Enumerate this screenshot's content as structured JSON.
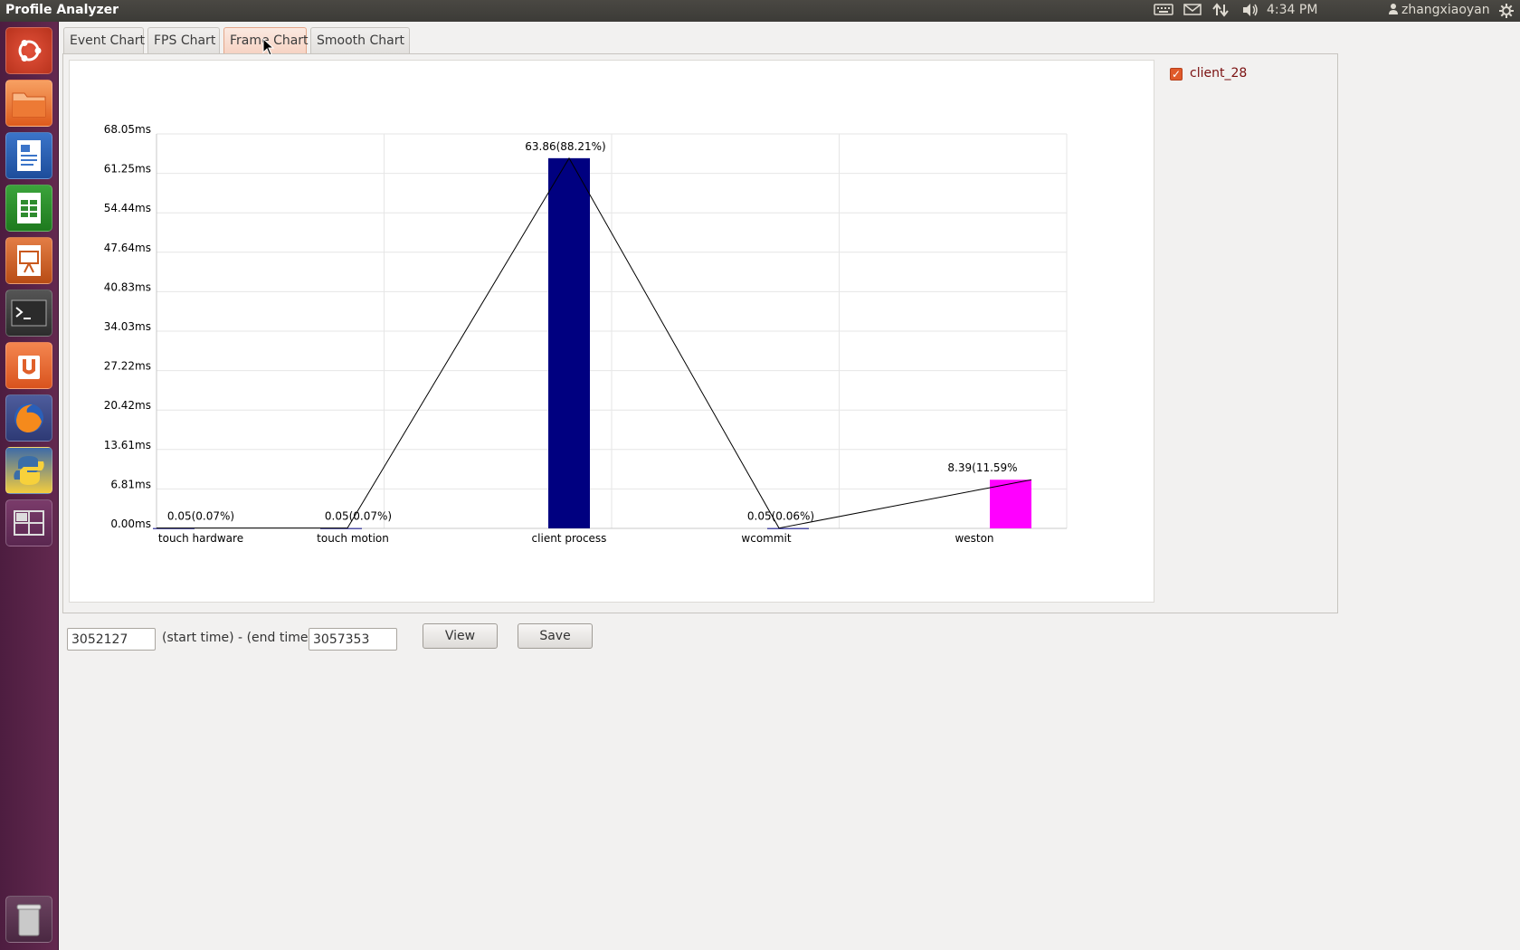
{
  "window": {
    "title": "Profile Analyzer"
  },
  "panel": {
    "clock": "4:34 PM",
    "user": "zhangxiaoyan"
  },
  "launcher": {
    "items": [
      "ubuntu-dash-icon",
      "files-icon",
      "writer-icon",
      "calc-icon",
      "impress-icon",
      "terminal-icon",
      "software-center-icon",
      "firefox-icon",
      "python-icon",
      "workspace-switcher-icon",
      "trash-icon"
    ]
  },
  "tabs": [
    {
      "label": "Event Chart",
      "active": false
    },
    {
      "label": "FPS Chart",
      "active": false
    },
    {
      "label": "Frame Chart",
      "active": true
    },
    {
      "label": "Smooth Chart",
      "active": false
    }
  ],
  "legend": {
    "label": "client_28",
    "checked": true
  },
  "chart_data": {
    "type": "bar",
    "categories": [
      "touch hardware",
      "touch motion",
      "client process",
      "wcommit",
      "weston"
    ],
    "values": [
      0.05,
      0.05,
      63.86,
      0.05,
      8.39
    ],
    "data_labels": [
      "0.05(0.07%)",
      "0.05(0.07%)",
      "63.86(88.21%)",
      "0.05(0.06%)",
      "8.39(11.59%"
    ],
    "bar_colors": [
      "#000080",
      "#000080",
      "#000080",
      "#000080",
      "#ff00ff"
    ],
    "line_overlay": true,
    "yticks": [
      "0.00ms",
      "6.81ms",
      "13.61ms",
      "20.42ms",
      "27.22ms",
      "34.03ms",
      "40.83ms",
      "47.64ms",
      "54.44ms",
      "61.25ms",
      "68.05ms"
    ],
    "ylim": [
      0,
      68.05
    ],
    "grid": true
  },
  "controls": {
    "start_time": "3052127",
    "range_label": "(start time) - (end time)",
    "end_time": "3057353",
    "view_label": "View",
    "save_label": "Save"
  }
}
